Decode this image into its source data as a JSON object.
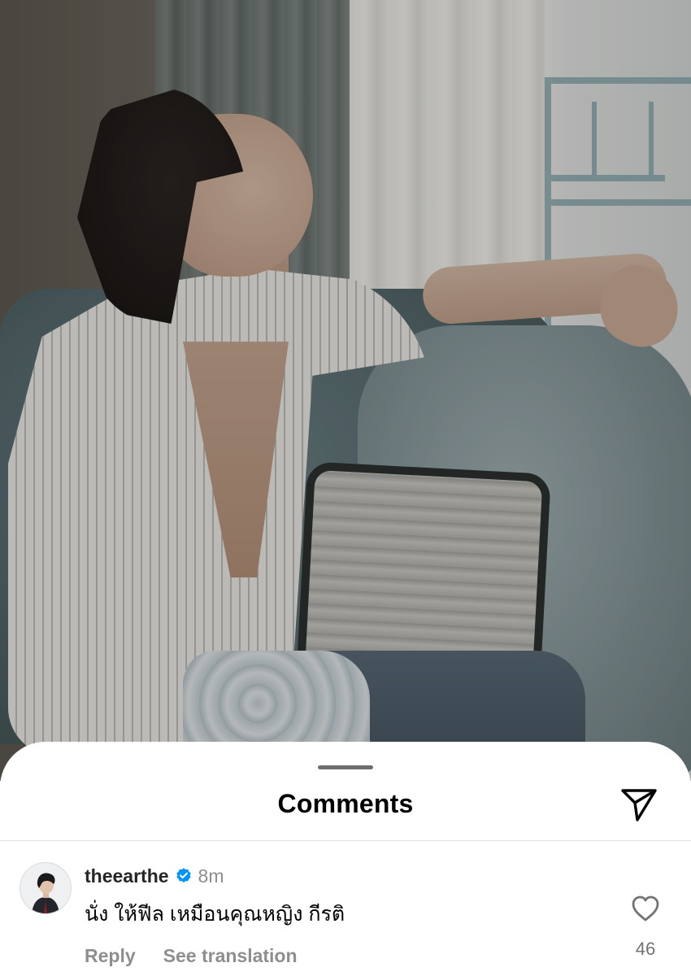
{
  "sheet": {
    "title": "Comments"
  },
  "comment": {
    "username": "theearthe",
    "verified": true,
    "timestamp": "8m",
    "text": "นั่ง ให้ฟีล เหมือนคุณหญิง กีรติ",
    "reply_label": "Reply",
    "translate_label": "See translation",
    "like_count": "46"
  },
  "icons": {
    "share": "paper-plane-icon",
    "like": "heart-outline-icon",
    "verified": "verified-badge-icon"
  },
  "colors": {
    "verified_blue": "#0095f6",
    "secondary_text": "#8e8e8e",
    "sheet_background": "#ffffff"
  }
}
